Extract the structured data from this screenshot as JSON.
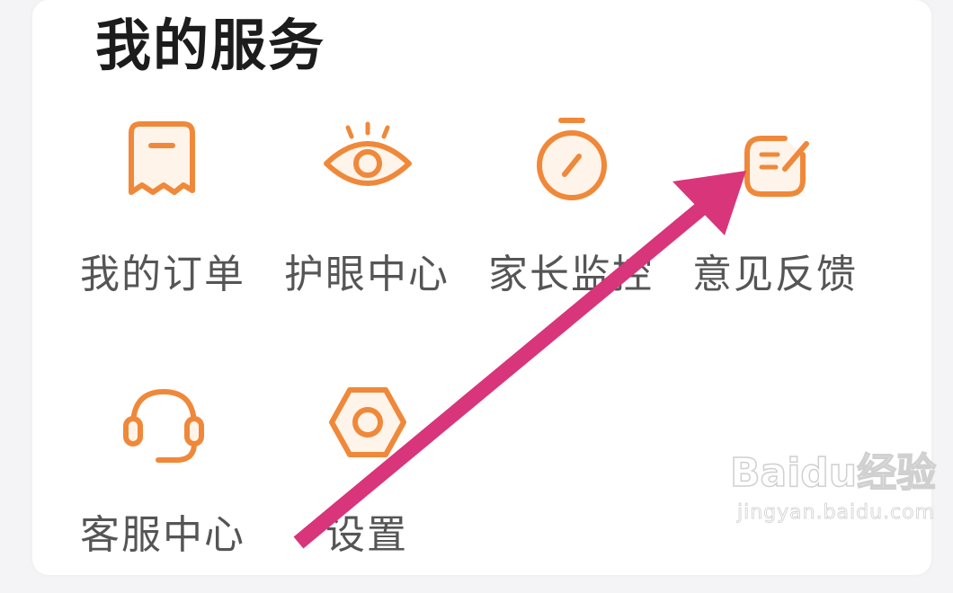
{
  "section": {
    "title": "我的服务"
  },
  "services": [
    {
      "label": "我的订单",
      "icon": "order-icon"
    },
    {
      "label": "护眼中心",
      "icon": "eye-icon"
    },
    {
      "label": "家长监控",
      "icon": "timer-icon"
    },
    {
      "label": "意见反馈",
      "icon": "feedback-icon"
    },
    {
      "label": "客服中心",
      "icon": "headset-icon"
    },
    {
      "label": "设置",
      "icon": "settings-icon"
    }
  ],
  "annotation": {
    "arrow_color": "#d8357a",
    "target": "意见反馈"
  },
  "watermark": {
    "logo": "Baidu经验",
    "url": "jingyan.baidu.com"
  },
  "colors": {
    "icon_accent": "#f0883a",
    "label_text": "#555555",
    "title_text": "#1c1c1c"
  }
}
